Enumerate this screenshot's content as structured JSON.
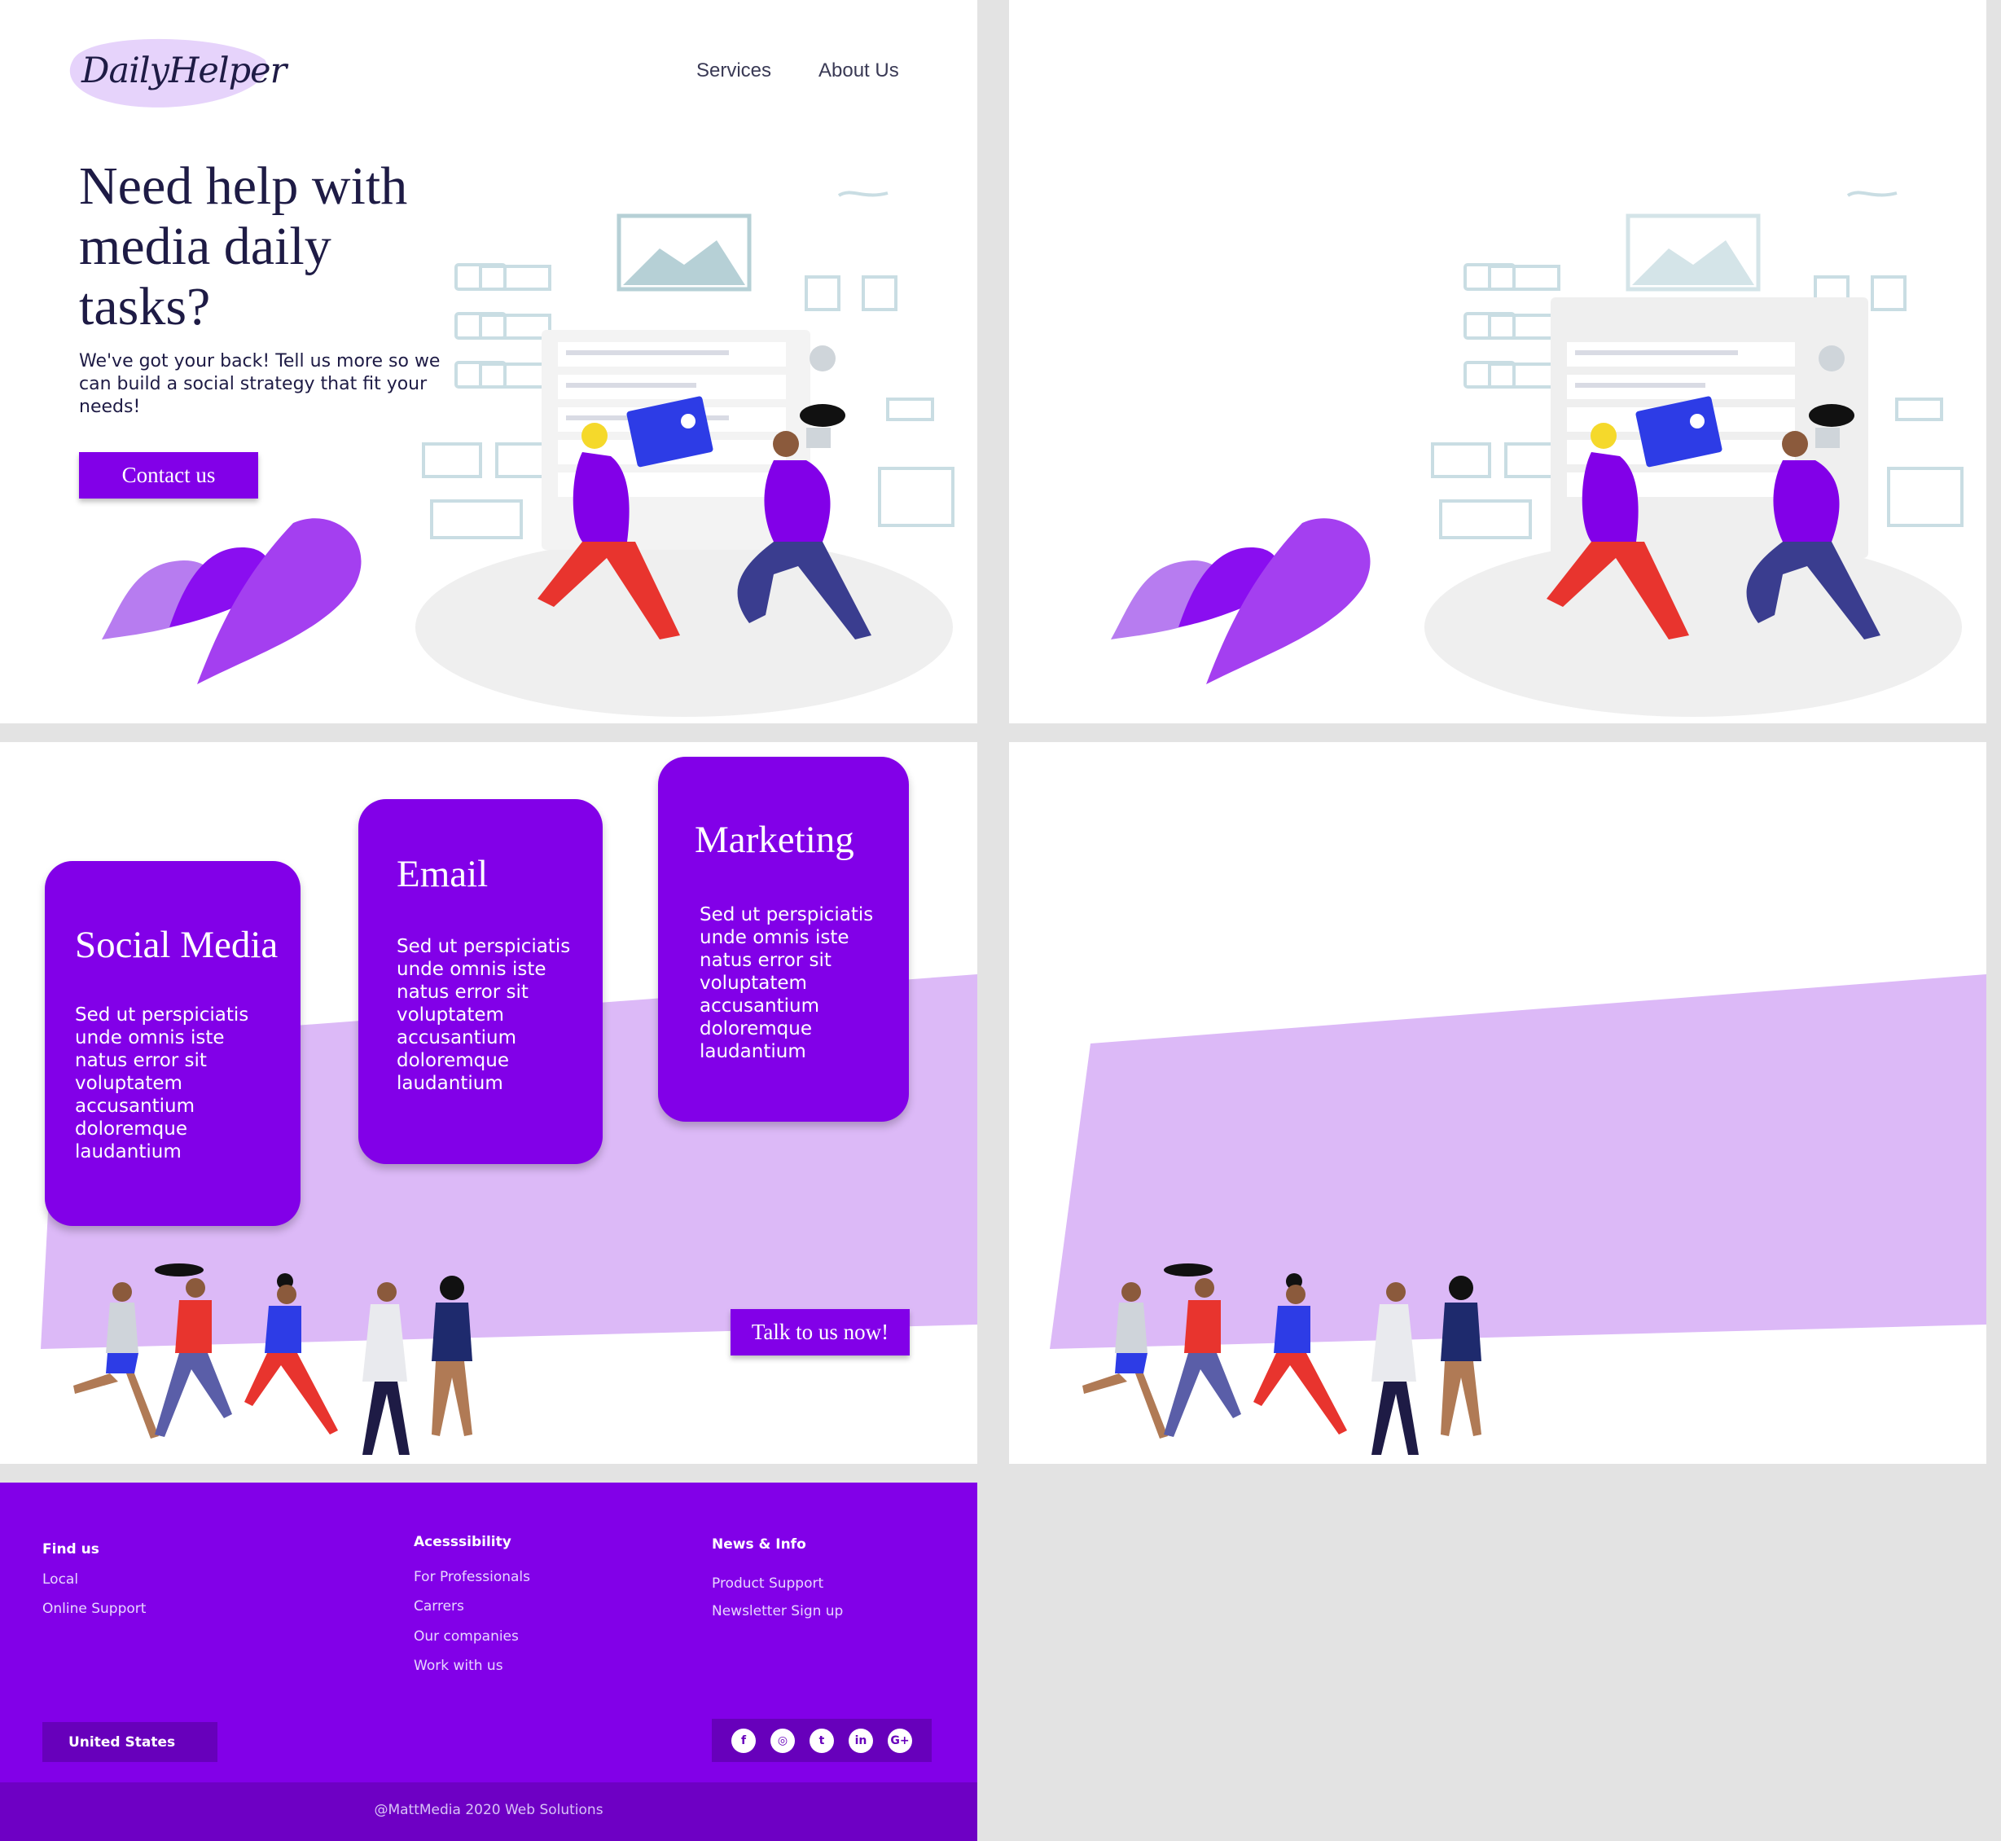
{
  "brand": {
    "logo_text": "DailyHelper"
  },
  "nav": {
    "items": [
      "Services",
      "About Us"
    ]
  },
  "hero": {
    "title": "Need help with media daily tasks?",
    "subtitle": "We've got your back! Tell us more so we can build a social strategy that fit your needs!",
    "cta_label": "Contact us"
  },
  "services": {
    "cards": [
      {
        "title": "Social Media",
        "body": "Sed ut perspiciatis unde omnis iste natus error sit voluptatem accusantium doloremque laudantium"
      },
      {
        "title": "Email",
        "body": "Sed ut perspiciatis unde omnis iste natus error sit voluptatem accusantium doloremque laudantium"
      },
      {
        "title": "Marketing",
        "body": "Sed ut perspiciatis unde omnis iste natus error sit voluptatem accusantium doloremque laudantium"
      }
    ],
    "talk_label": "Talk to us now!"
  },
  "footer": {
    "columns": [
      {
        "heading": "Find us",
        "links": [
          "Local",
          "Online Support"
        ]
      },
      {
        "heading": "Acesssibility",
        "links": [
          "For Professionals",
          "Carrers",
          "Our companies",
          "Work with us"
        ]
      },
      {
        "heading": "News & Info",
        "links": [
          "Product Support",
          "Newsletter Sign up"
        ]
      }
    ],
    "country": "United States",
    "social": [
      {
        "icon": "facebook-icon",
        "glyph": "f"
      },
      {
        "icon": "instagram-icon",
        "glyph": "◎"
      },
      {
        "icon": "twitter-icon",
        "glyph": "t"
      },
      {
        "icon": "linkedin-icon",
        "glyph": "in"
      },
      {
        "icon": "google-plus-icon",
        "glyph": "G+"
      }
    ],
    "copyright": "@MattMedia 2020 Web Solutions"
  },
  "colors": {
    "primary": "#8200e8",
    "primary_dark": "#6700bb",
    "lavender": "#dcb9f7",
    "heading": "#1e1b45",
    "page_bg": "#e3e3e3"
  }
}
